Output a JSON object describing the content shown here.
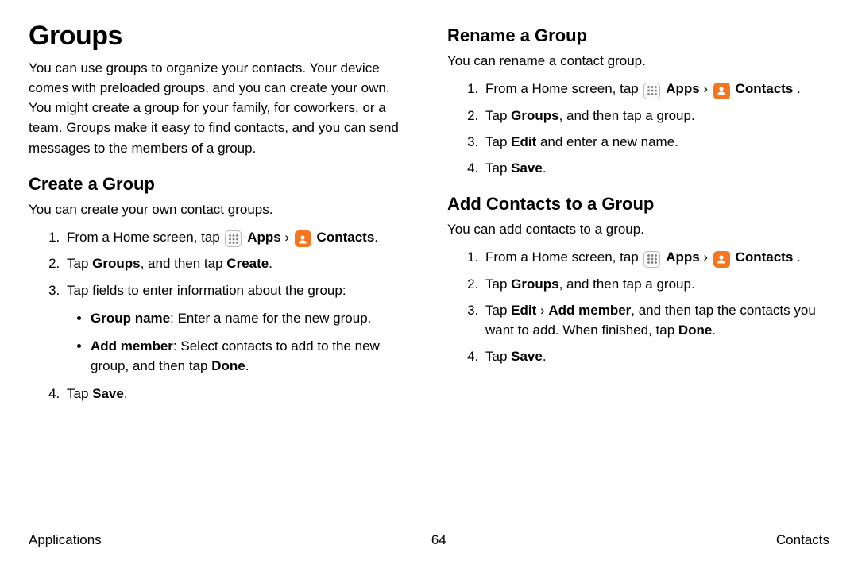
{
  "left": {
    "title": "Groups",
    "intro": "You can use groups to organize your contacts. Your device comes with preloaded groups, and you can create your own. You might create a group for your family, for coworkers, or a team. Groups make it easy to find contacts, and you can send messages to the members of a group.",
    "create": {
      "heading": "Create a Group",
      "intro": "You can create your own contact groups.",
      "s1_pre": "From a Home screen, tap ",
      "s1_apps": "Apps",
      "s1_sep": " › ",
      "s1_contacts": "Contacts",
      "s1_end": ".",
      "s2_pre": "Tap ",
      "s2_b1": "Groups",
      "s2_mid": ", and then tap ",
      "s2_b2": "Create",
      "s2_end": ".",
      "s3": "Tap fields to enter information about the group:",
      "bul1_b": "Group name",
      "bul1_rest": ": Enter a name for the new group.",
      "bul2_b": "Add member",
      "bul2_mid": ": Select contacts to add to the new group, and then tap ",
      "bul2_b2": "Done",
      "bul2_end": ".",
      "s4_pre": "Tap ",
      "s4_b": "Save",
      "s4_end": "."
    }
  },
  "right": {
    "rename": {
      "heading": "Rename a Group",
      "intro": "You can rename a contact group.",
      "s1_pre": "From a Home screen, tap ",
      "s1_apps": "Apps",
      "s1_sep": " › ",
      "s1_contacts": "Contacts",
      "s1_end": " .",
      "s2_pre": "Tap ",
      "s2_b": "Groups",
      "s2_end": ", and then tap a group.",
      "s3_pre": "Tap ",
      "s3_b": "Edit",
      "s3_end": " and enter a new name.",
      "s4_pre": "Tap ",
      "s4_b": "Save",
      "s4_end": "."
    },
    "add": {
      "heading": "Add Contacts to a Group",
      "intro": "You can add contacts to a group.",
      "s1_pre": "From a Home screen, tap ",
      "s1_apps": "Apps",
      "s1_sep": " › ",
      "s1_contacts": "Contacts",
      "s1_end": " .",
      "s2_pre": "Tap ",
      "s2_b": "Groups",
      "s2_end": ", and then tap a group.",
      "s3_pre": "Tap ",
      "s3_b1": "Edit",
      "s3_sep": " › ",
      "s3_b2": "Add member",
      "s3_mid": ", and then tap the contacts you want to add. When finished, tap ",
      "s3_b3": "Done",
      "s3_end": ".",
      "s4_pre": "Tap ",
      "s4_b": "Save",
      "s4_end": "."
    }
  },
  "footer": {
    "left": "Applications",
    "page": "64",
    "right": "Contacts"
  },
  "icons": {
    "apps": "apps-grid-icon",
    "contacts": "contacts-person-icon"
  }
}
